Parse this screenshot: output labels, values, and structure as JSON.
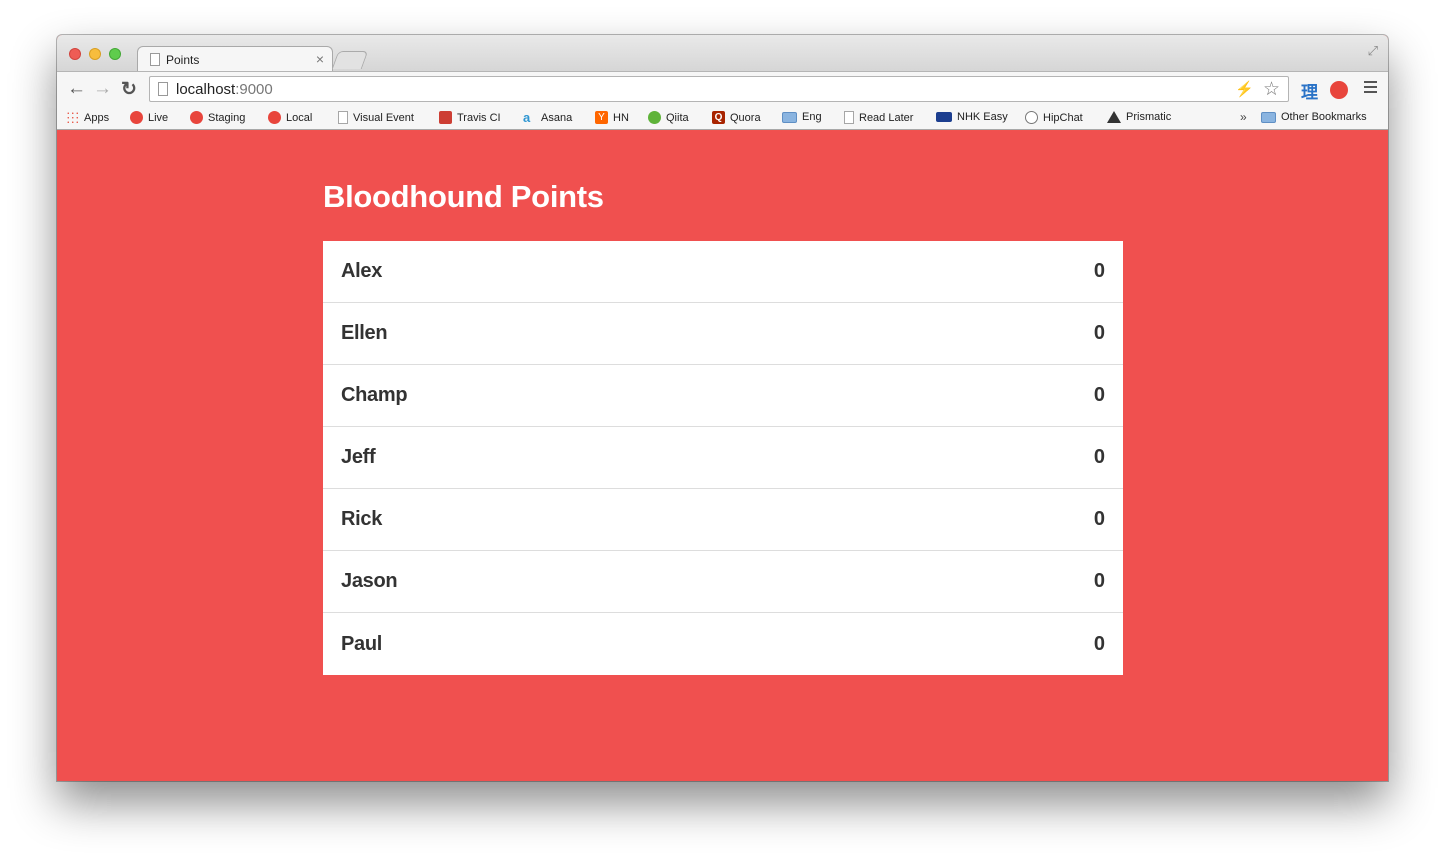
{
  "browser": {
    "tab_title": "Points",
    "tab_close": "×",
    "url_host": "localhost",
    "url_port": ":9000",
    "ext_kanji": "理",
    "bookmarks": [
      {
        "label": "Apps",
        "icon": "apps-grid-icon"
      },
      {
        "label": "Live",
        "icon": "red-app-icon"
      },
      {
        "label": "Staging",
        "icon": "red-app-icon"
      },
      {
        "label": "Local",
        "icon": "red-app-icon"
      },
      {
        "label": "Visual Event",
        "icon": "page-icon"
      },
      {
        "label": "Travis CI",
        "icon": "travis-icon"
      },
      {
        "label": "Asana",
        "icon": "asana-icon"
      },
      {
        "label": "HN",
        "icon": "hn-icon"
      },
      {
        "label": "Qiita",
        "icon": "qiita-icon"
      },
      {
        "label": "Quora",
        "icon": "quora-icon"
      },
      {
        "label": "Eng",
        "icon": "folder-icon"
      },
      {
        "label": "Read Later",
        "icon": "page-icon"
      },
      {
        "label": "NHK Easy",
        "icon": "nhk-icon"
      },
      {
        "label": "HipChat",
        "icon": "hipchat-icon"
      },
      {
        "label": "Prismatic",
        "icon": "prismatic-icon"
      }
    ],
    "bookmarks_overflow": "»",
    "other_bookmarks": "Other Bookmarks",
    "hn_glyph": "Y",
    "quora_glyph": "Q",
    "asana_glyph": "a"
  },
  "page": {
    "title": "Bloodhound Points",
    "rows": [
      {
        "name": "Alex",
        "points": "0"
      },
      {
        "name": "Ellen",
        "points": "0"
      },
      {
        "name": "Champ",
        "points": "0"
      },
      {
        "name": "Jeff",
        "points": "0"
      },
      {
        "name": "Rick",
        "points": "0"
      },
      {
        "name": "Jason",
        "points": "0"
      },
      {
        "name": "Paul",
        "points": "0"
      }
    ]
  },
  "colors": {
    "background": "#f0504f",
    "card": "#ffffff",
    "text": "#333333"
  }
}
